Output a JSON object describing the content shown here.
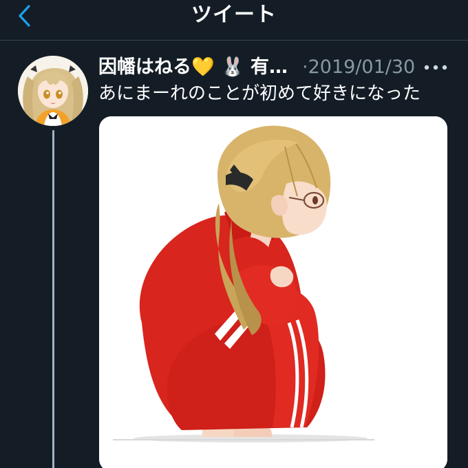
{
  "header": {
    "title": "ツイート",
    "back_icon": "chevron-left-icon"
  },
  "tweet": {
    "display_name": "因幡はねる💛 🐰 有…",
    "timestamp": "·2019/01/30",
    "more_icon": "more-horizontal-icon",
    "text": "あにまーれのことが初めて好きになった",
    "avatar_icon": "user-avatar",
    "media_icon": "anime-girl-red-tracksuit-illustration"
  },
  "colors": {
    "background": "#141d26",
    "accent": "#1da1f2",
    "secondary_text": "#8899a6",
    "divider": "#38444d"
  }
}
